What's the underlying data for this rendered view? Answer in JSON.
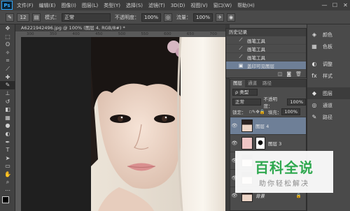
{
  "app": {
    "logo": "Ps"
  },
  "menu": [
    "文件(F)",
    "编辑(E)",
    "图像(I)",
    "图层(L)",
    "类型(Y)",
    "选择(S)",
    "滤镜(T)",
    "3D(D)",
    "视图(V)",
    "窗口(W)",
    "帮助(H)"
  ],
  "window_controls": [
    "—",
    "☐",
    "✕"
  ],
  "options": {
    "brush_size": "12",
    "mode_label": "模式：",
    "mode_value": "正常",
    "opacity_label": "不透明度：",
    "opacity_value": "100%",
    "flow_label": "流量：",
    "flow_value": "100%"
  },
  "document": {
    "tab_title": "A6221942496.jpg @ 100% (图层 4, RGB/8#) *",
    "ruler_ticks": [
      "300",
      "350",
      "400",
      "450",
      "500",
      "550",
      "600",
      "650",
      "700"
    ]
  },
  "history": {
    "tab": "历史记录",
    "items": [
      {
        "label": "画笔工具",
        "icon": "brush-icon"
      },
      {
        "label": "画笔工具",
        "icon": "brush-icon"
      },
      {
        "label": "画笔工具",
        "icon": "brush-icon"
      },
      {
        "label": "盖印可见图层",
        "icon": "stamp-icon",
        "selected": true
      }
    ]
  },
  "right_panel": {
    "items": [
      {
        "label": "颜色",
        "icon": "color-icon"
      },
      {
        "label": "色板",
        "icon": "swatch-icon"
      },
      {
        "label": "调整",
        "icon": "adjust-icon"
      },
      {
        "label": "样式",
        "icon": "style-icon"
      },
      {
        "label": "图层",
        "icon": "layers-icon",
        "active": true
      },
      {
        "label": "通道",
        "icon": "channels-icon"
      },
      {
        "label": "路径",
        "icon": "paths-icon"
      }
    ]
  },
  "layers": {
    "tabs": [
      "图层",
      "通道",
      "路径"
    ],
    "kind_filter": "ρ 类型",
    "blend_mode": "正常",
    "opacity_label": "不透明度：",
    "opacity_value": "100%",
    "lock_label": "锁定：",
    "fill_label": "填充：",
    "fill_value": "100%",
    "items": [
      {
        "name": "图层 4",
        "selected": true
      },
      {
        "name": "图层 3"
      },
      {
        "name": ""
      },
      {
        "name": ""
      },
      {
        "name": "背景"
      }
    ]
  },
  "watermark": {
    "title": "百科全说",
    "subtitle": "助你轻松解决"
  }
}
